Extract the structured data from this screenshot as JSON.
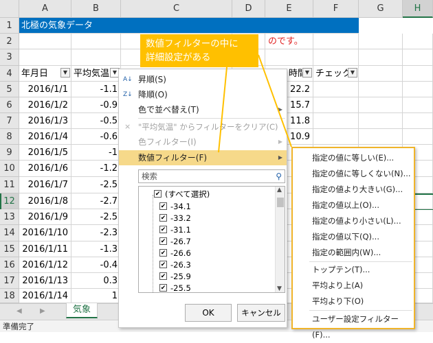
{
  "columns": [
    "A",
    "B",
    "C",
    "D",
    "E",
    "F",
    "G",
    "H"
  ],
  "rows": [
    "1",
    "2",
    "3",
    "4",
    "5",
    "6",
    "7",
    "8",
    "9",
    "10",
    "11",
    "12",
    "13",
    "14",
    "15",
    "16",
    "17",
    "18"
  ],
  "title_cell": "北極の気象データ",
  "row2_text": "のです。",
  "headers": {
    "a": "年月日",
    "b": "平均気温",
    "e_partial": "時間",
    "f_partial": "チェック"
  },
  "dates": [
    "2016/1/1",
    "2016/1/2",
    "2016/1/3",
    "2016/1/4",
    "2016/1/5",
    "2016/1/6",
    "2016/1/7",
    "2016/1/8",
    "2016/1/9",
    "2016/1/10",
    "2016/1/11",
    "2016/1/12",
    "2016/1/13",
    "2016/1/14"
  ],
  "temps": [
    "-1.1",
    "-0.9",
    "-0.5",
    "-0.6",
    "-1",
    "-1.2",
    "-2.5",
    "-2.7",
    "-2.5",
    "-2.3",
    "-1.3",
    "-0.4",
    "0.3",
    "1"
  ],
  "col_e_values": [
    "22.2",
    "15.7",
    "11.8",
    "10.9"
  ],
  "callout": {
    "line1": "数値フィルターの中に",
    "line2": "詳細設定がある"
  },
  "filter_menu": {
    "sort_asc": "昇順(S)",
    "sort_desc": "降順(O)",
    "sort_color": "色で並べ替え(T)",
    "clear_filter": "\"平均気温\" からフィルターをクリア(C)",
    "color_filter": "色フィルター(I)",
    "number_filter": "数値フィルター(F)",
    "search_placeholder": "検索",
    "select_all": "(すべて選択)",
    "values": [
      "-34.1",
      "-33.2",
      "-31.1",
      "-26.7",
      "-26.6",
      "-26.3",
      "-25.9",
      "-25.5"
    ],
    "ok": "OK",
    "cancel": "キャンセル"
  },
  "submenu": [
    "指定の値に等しい(E)...",
    "指定の値に等しくない(N)...",
    "指定の値より大きい(G)...",
    "指定の値以上(O)...",
    "指定の値より小さい(L)...",
    "指定の値以下(Q)...",
    "指定の範囲内(W)...",
    "トップテン(T)...",
    "平均より上(A)",
    "平均より下(O)",
    "ユーザー設定フィルター(F)..."
  ],
  "sheet_tab": "気象",
  "status": "準備完了",
  "colors": {
    "title_fill": "#0070c0",
    "callout_fill": "#ffc000",
    "highlight": "#f6d98a",
    "sheet_green": "#217346"
  }
}
